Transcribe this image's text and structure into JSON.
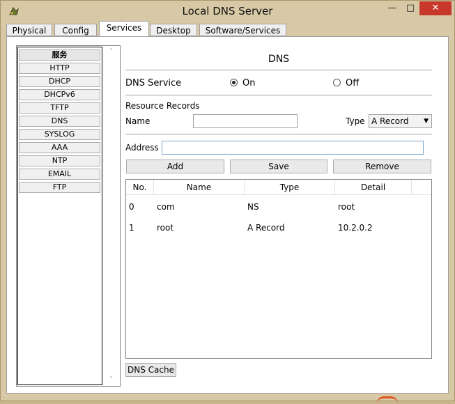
{
  "window": {
    "title": "Local DNS Server",
    "minimize": "—",
    "maximize": "□",
    "close": "✕",
    "close_color": "#c7382b"
  },
  "tabs": [
    {
      "label": "Physical"
    },
    {
      "label": "Config"
    },
    {
      "label": "Services",
      "active": true
    },
    {
      "label": "Desktop"
    },
    {
      "label": "Software/Services"
    }
  ],
  "sidebar": {
    "items": [
      {
        "label": "服务"
      },
      {
        "label": "HTTP"
      },
      {
        "label": "DHCP"
      },
      {
        "label": "DHCPv6"
      },
      {
        "label": "TFTP"
      },
      {
        "label": "DNS"
      },
      {
        "label": "SYSLOG"
      },
      {
        "label": "AAA"
      },
      {
        "label": "NTP"
      },
      {
        "label": "EMAIL"
      },
      {
        "label": "FTP"
      }
    ],
    "scroll_up": "˄",
    "scroll_down": "˅"
  },
  "dns": {
    "title": "DNS",
    "service_label": "DNS Service",
    "on_label": "On",
    "off_label": "Off",
    "service_on": true,
    "resource_records_label": "Resource Records",
    "name_label": "Name",
    "name_value": "",
    "type_label": "Type",
    "type_value": "A Record",
    "address_label": "Address",
    "address_value": "",
    "add_button": "Add",
    "save_button": "Save",
    "remove_button": "Remove",
    "cache_button": "DNS Cache"
  },
  "table": {
    "columns": [
      "No.",
      "Name",
      "Type",
      "Detail"
    ],
    "rows": [
      {
        "no": "0",
        "name": "com",
        "type": "NS",
        "detail": "root"
      },
      {
        "no": "1",
        "name": "root",
        "type": "A Record",
        "detail": "10.2.0.2"
      }
    ]
  }
}
